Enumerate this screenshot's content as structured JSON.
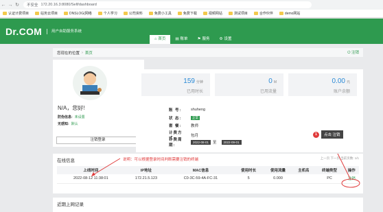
{
  "browser": {
    "security": "不安全",
    "url": "172.20.16.3:8080/Self/dashboard",
    "bookmarks": [
      "认证计费项目",
      "站务云项目",
      "DNSLOG(网络",
      "个人学习",
      "公司资料",
      "免费小工具",
      "免费下载",
      "视频网站",
      "测试项目",
      "合作伙伴",
      "demo网站"
    ]
  },
  "header": {
    "logo": "Dr.COM",
    "subtitle": "用户自助服务系统",
    "nav": [
      {
        "label": "首页",
        "icon": "home-icon",
        "active": true
      },
      {
        "label": "账单",
        "icon": "bill-icon",
        "active": false
      },
      {
        "label": "服务",
        "icon": "service-icon",
        "active": false
      },
      {
        "label": "设置",
        "icon": "gear-icon",
        "active": false
      }
    ]
  },
  "location": {
    "prefix": "您现在的位置",
    "current": "首页",
    "logout": "注销"
  },
  "profile": {
    "greeting": "N/A，您好!",
    "security_label": "防伪信息:",
    "security_value": "未设置",
    "sense_label": "无感知:",
    "sense_value": "默认",
    "logout_button": "注销登录"
  },
  "stats": [
    {
      "value": "159",
      "unit": "分钟",
      "label": "已用时长"
    },
    {
      "value": "0",
      "unit": "M",
      "label": "已用流量"
    },
    {
      "value": "0.00",
      "unit": "元",
      "label": "账户余额"
    }
  ],
  "account": {
    "account_label": "账 号:",
    "account_value": "shuheng",
    "status_label": "状 态:",
    "status_value": "正常",
    "plan_label": "套 餐:",
    "plan_value": "教师",
    "billing_label": "计费方式:",
    "billing_value": "包月",
    "period_label": "计费周期:",
    "period_start": "2022-08-01",
    "period_end": "2022-09-01"
  },
  "click_note": {
    "badge": "1",
    "text": "点击 注销"
  },
  "online": {
    "title": "在线信息",
    "annotation": "说明：可以根据登录时间判断需要注销的终端",
    "pagination": "上一页  下一页  当前页数: 1/1",
    "columns": [
      "上线时间",
      "IP地址",
      "MAC信息",
      "使用时长",
      "使用流量",
      "主机名",
      "终端类型",
      "操作"
    ],
    "rows": [
      [
        "2022-08-12 11:38:01",
        "172.21.5.123",
        "C0-3C-59-4A-FC-31",
        "5",
        "0.000",
        "",
        "PC",
        "注销"
      ]
    ]
  },
  "recent": {
    "title": "近期上网记录"
  },
  "colors": {
    "brand": "#2e9a4f",
    "accent_blue": "#2b8ad6",
    "annotation_red": "#e03b3b"
  }
}
